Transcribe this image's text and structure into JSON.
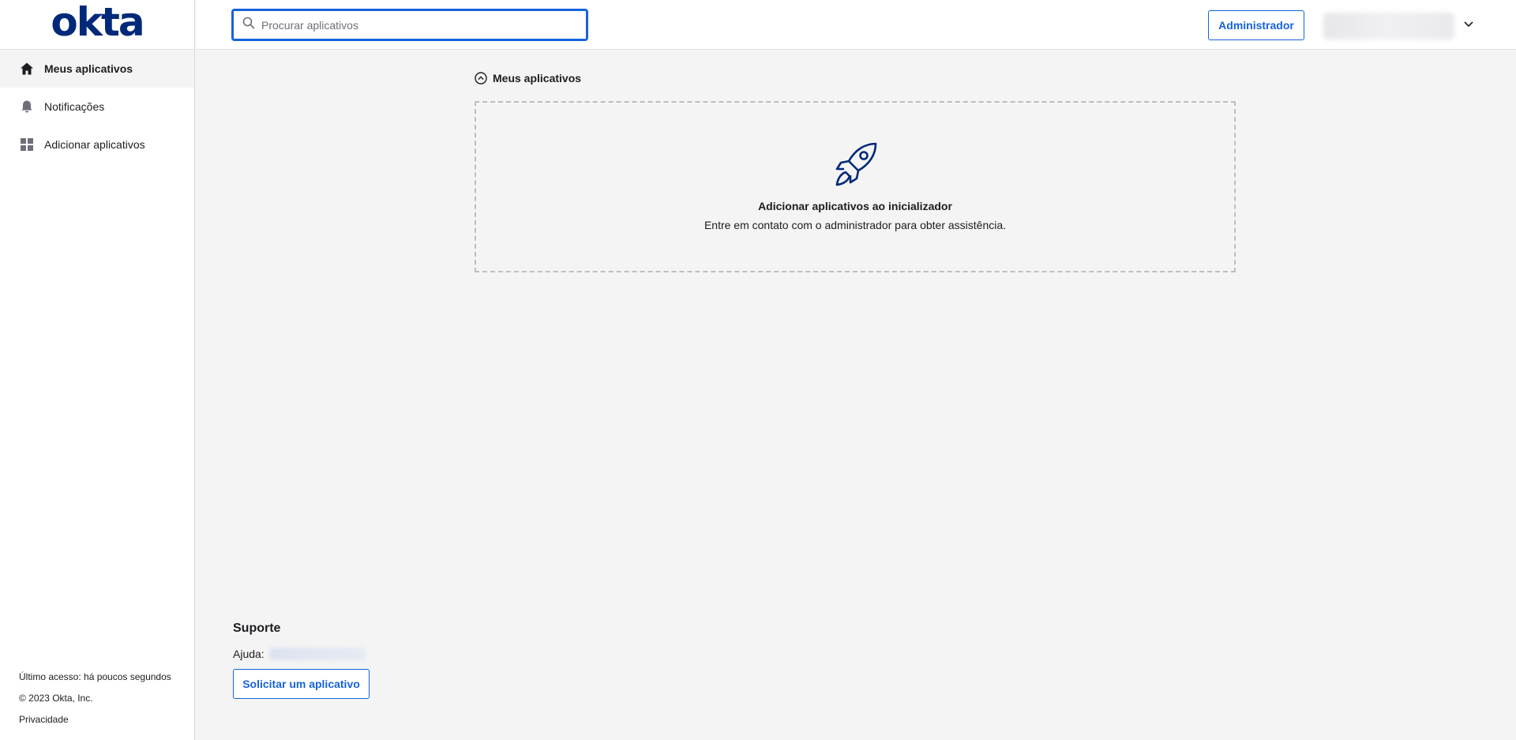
{
  "brand": {
    "logo_text": "okta",
    "color": "#00297a"
  },
  "accent_color": "#1662dd",
  "sidebar": {
    "items": [
      {
        "label": "Meus aplicativos",
        "icon": "home-icon",
        "active": true
      },
      {
        "label": "Notificações",
        "icon": "bell-icon",
        "active": false
      },
      {
        "label": "Adicionar aplicativos",
        "icon": "grid-icon",
        "active": false
      }
    ],
    "footer": {
      "last_access": "Último acesso: há poucos segundos",
      "copyright": "© 2023 Okta, Inc.",
      "privacy": "Privacidade"
    }
  },
  "header": {
    "search": {
      "placeholder": "Procurar aplicativos",
      "value": ""
    },
    "admin_label": "Administrador",
    "user_menu_icon": "chevron-down-icon"
  },
  "main": {
    "section_title": "Meus aplicativos",
    "section_icon": "chevron-up-circle-icon",
    "empty_state": {
      "icon": "rocket-icon",
      "title": "Adicionar aplicativos ao inicializador",
      "subtitle": "Entre em contato com o administrador para obter assistência."
    }
  },
  "support": {
    "title": "Suporte",
    "help_label": "Ajuda:",
    "request_button": "Solicitar um aplicativo"
  }
}
